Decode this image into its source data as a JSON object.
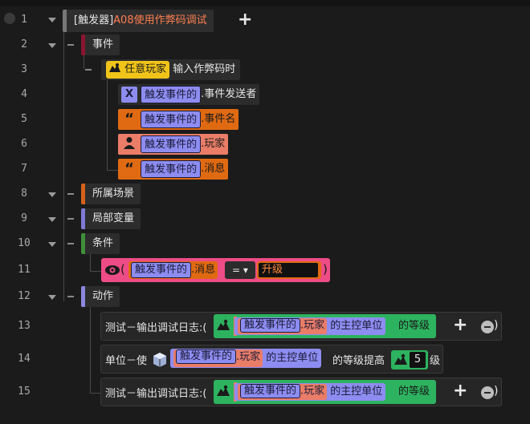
{
  "colors": {
    "background": "#1b1b1b",
    "trigger_title": "#ff7f50",
    "event_red": "#8a1530",
    "scope_orange": "#d4621a",
    "vars_purple": "#7e7ad6",
    "cond_green": "#3f8f3a",
    "action_purple": "#8b87de",
    "pill_yellow": "#f0c419",
    "pill_lavender": "#8d8cf0",
    "pill_orange": "#e06a12",
    "pill_salmon": "#e97d68",
    "pill_pink": "#ee4c86",
    "pill_green": "#2db35f"
  },
  "line_numbers": [
    "1",
    "2",
    "3",
    "4",
    "5",
    "6",
    "7",
    "8",
    "9",
    "10",
    "11",
    "12",
    "13",
    "14",
    "15"
  ],
  "trigger": {
    "bracket_label": "[触发器]",
    "name": "A08使用作弊码调试",
    "add_symbol": "+"
  },
  "event": {
    "header": "事件",
    "source_pill": "任意玩家",
    "action_text": "输入作弊码时",
    "params": [
      {
        "icon": "x-icon",
        "icon_glyph": "X",
        "pill": "触发事件的",
        "suffix": ".事件发送者"
      },
      {
        "icon": "quote-icon",
        "icon_glyph": "“",
        "pill": "触发事件的",
        "suffix": ".事件名"
      },
      {
        "icon": "person-icon",
        "icon_glyph": "●",
        "pill": "触发事件的",
        "suffix": ".玩家"
      },
      {
        "icon": "quote-icon",
        "icon_glyph": "“",
        "pill": "触发事件的",
        "suffix": ".消息"
      }
    ]
  },
  "scope": {
    "header": "所属场景"
  },
  "local_vars": {
    "header": "局部变量"
  },
  "conditions": {
    "header": "条件",
    "row": {
      "open_paren": "(",
      "pill": "触发事件的",
      "suffix": ".消息",
      "operator": "=",
      "operator_chevron": "▾",
      "value": "升级",
      "close_paren": ")"
    }
  },
  "actions": {
    "header": "动作",
    "rows": [
      {
        "prefix": "测试－输出调试日志:(",
        "pill": "触发事件的",
        "suffix": ".玩家",
        "mid": "的主控单位",
        "tail": "的等级",
        "add": "+",
        "close": ")"
      },
      {
        "prefix": "单位－使",
        "pill": "触发事件的",
        "suffix": ".玩家",
        "mid": "的主控单位",
        "tail": "的等级提高",
        "number": "5",
        "unit": "级"
      },
      {
        "prefix": "测试－输出调试日志:(",
        "pill": "触发事件的",
        "suffix": ".玩家",
        "mid": "的主控单位",
        "tail": "的等级",
        "add": "+",
        "close": ")"
      }
    ]
  }
}
